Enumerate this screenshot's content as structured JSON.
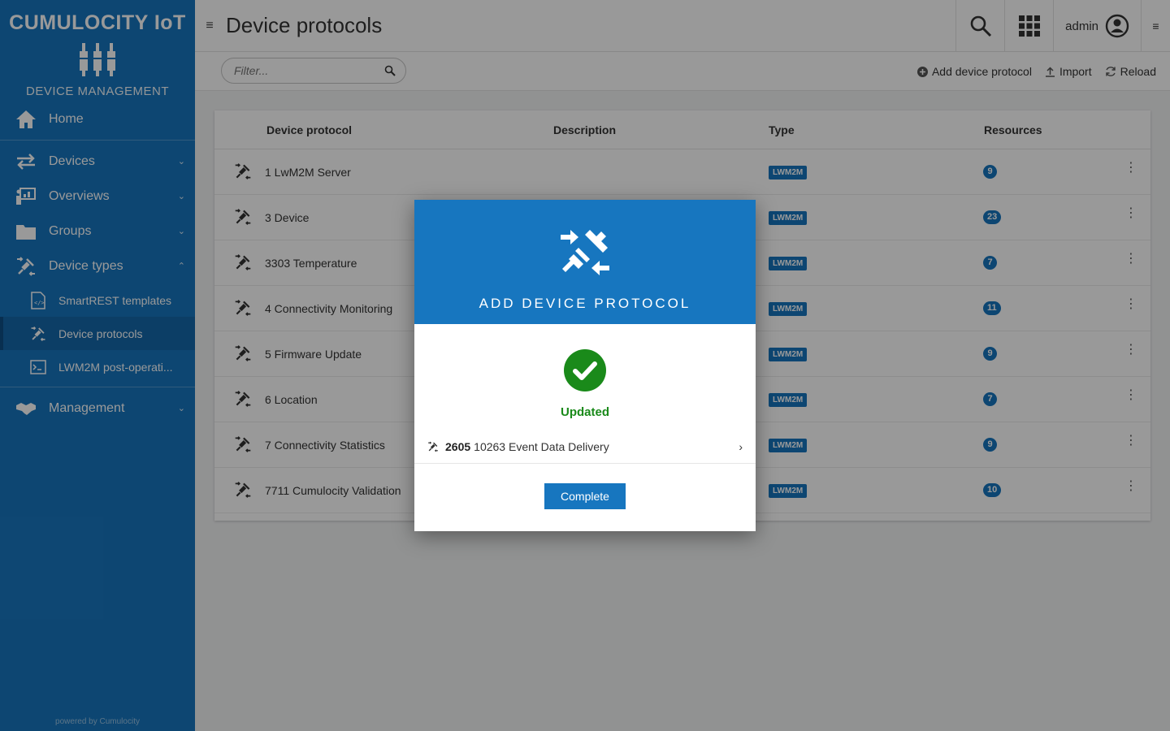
{
  "brand": {
    "title": "CUMULOCITY IoT",
    "subtitle": "DEVICE MANAGEMENT",
    "powered": "powered by Cumulocity"
  },
  "nav": {
    "home": "Home",
    "devices": "Devices",
    "overviews": "Overviews",
    "groups": "Groups",
    "device_types": "Device types",
    "smartrest": "SmartREST templates",
    "device_protocols": "Device protocols",
    "lwm2m_post": "LWM2M post-operati...",
    "management": "Management"
  },
  "header": {
    "title": "Device protocols",
    "user": "admin"
  },
  "actionbar": {
    "filter_placeholder": "Filter...",
    "add": "Add device protocol",
    "import": "Import",
    "reload": "Reload"
  },
  "table": {
    "columns": {
      "protocol": "Device protocol",
      "description": "Description",
      "type": "Type",
      "resources": "Resources"
    },
    "rows": [
      {
        "name": "1 LwM2M Server",
        "type": "LWM2M",
        "resources": "9"
      },
      {
        "name": "3 Device",
        "type": "LWM2M",
        "resources": "23"
      },
      {
        "name": "3303 Temperature",
        "type": "LWM2M",
        "resources": "7"
      },
      {
        "name": "4 Connectivity Monitoring",
        "type": "LWM2M",
        "resources": "11"
      },
      {
        "name": "5 Firmware Update",
        "type": "LWM2M",
        "resources": "9"
      },
      {
        "name": "6 Location",
        "type": "LWM2M",
        "resources": "7"
      },
      {
        "name": "7 Connectivity Statistics",
        "type": "LWM2M",
        "resources": "9"
      },
      {
        "name": "7711 Cumulocity Validation",
        "type": "LWM2M",
        "resources": "10"
      }
    ]
  },
  "modal": {
    "title": "ADD DEVICE PROTOCOL",
    "status": "Updated",
    "item_id": "2605",
    "item_name": "10263 Event Data Delivery",
    "complete": "Complete"
  },
  "colors": {
    "brand": "#1776bf",
    "success": "#1a8a1a"
  }
}
